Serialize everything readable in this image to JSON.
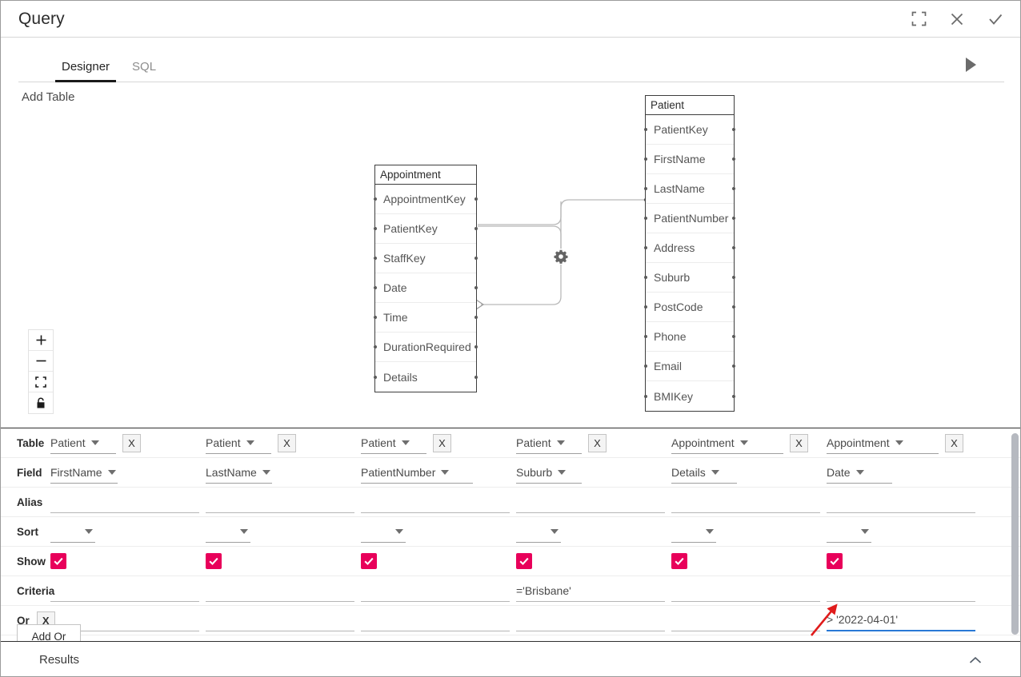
{
  "window": {
    "title": "Query",
    "actions": [
      {
        "name": "maximize-icon",
        "label": "Maximize"
      },
      {
        "name": "close-icon",
        "label": "Close"
      },
      {
        "name": "confirm-icon",
        "label": "Confirm"
      }
    ]
  },
  "tabs": {
    "items": [
      {
        "label": "Designer",
        "active": true
      },
      {
        "label": "SQL",
        "active": false
      }
    ],
    "run_label": "Run"
  },
  "canvas": {
    "add_table_label": "Add Table",
    "zoom_controls": [
      {
        "name": "zoom-in-button",
        "glyph": "+"
      },
      {
        "name": "zoom-out-button",
        "glyph": "−"
      },
      {
        "name": "fit-to-screen-button",
        "glyph": "fit"
      },
      {
        "name": "lock-button",
        "glyph": "lock"
      }
    ],
    "tables": [
      {
        "name": "Appointment",
        "fields": [
          "AppointmentKey",
          "PatientKey",
          "StaffKey",
          "Date",
          "Time",
          "DurationRequired",
          "Details"
        ]
      },
      {
        "name": "Patient",
        "fields": [
          "PatientKey",
          "FirstName",
          "LastName",
          "PatientNumber",
          "Address",
          "Suburb",
          "PostCode",
          "Phone",
          "Email",
          "BMIKey"
        ]
      }
    ],
    "join": {
      "from_table": "Appointment",
      "from_field": "PatientKey",
      "to_table": "Patient",
      "to_field": "PatientKey",
      "settings_icon": "gear-icon"
    }
  },
  "grid": {
    "row_labels": {
      "table": "Table",
      "field": "Field",
      "alias": "Alias",
      "sort": "Sort",
      "show": "Show",
      "criteria": "Criteria",
      "or": "Or"
    },
    "remove_label": "X",
    "add_or_label": "Add Or",
    "checkbox_color": "#e8005a",
    "focus_color": "#2979d6",
    "columns": [
      {
        "table": "Patient",
        "field": "FirstName",
        "alias": "",
        "sort": "",
        "show": true,
        "criteria": "",
        "or": ""
      },
      {
        "table": "Patient",
        "field": "LastName",
        "alias": "",
        "sort": "",
        "show": true,
        "criteria": "",
        "or": ""
      },
      {
        "table": "Patient",
        "field": "PatientNumber",
        "alias": "",
        "sort": "",
        "show": true,
        "criteria": "",
        "or": ""
      },
      {
        "table": "Patient",
        "field": "Suburb",
        "alias": "",
        "sort": "",
        "show": true,
        "criteria": "='Brisbane'",
        "or": ""
      },
      {
        "table": "Appointment",
        "field": "Details",
        "alias": "",
        "sort": "",
        "show": true,
        "criteria": "",
        "or": ""
      },
      {
        "table": "Appointment",
        "field": "Date",
        "alias": "",
        "sort": "",
        "show": true,
        "criteria": "",
        "or": "> '2022-04-01'"
      }
    ]
  },
  "results": {
    "label": "Results",
    "toggle_icon": "chevron-up-icon"
  }
}
